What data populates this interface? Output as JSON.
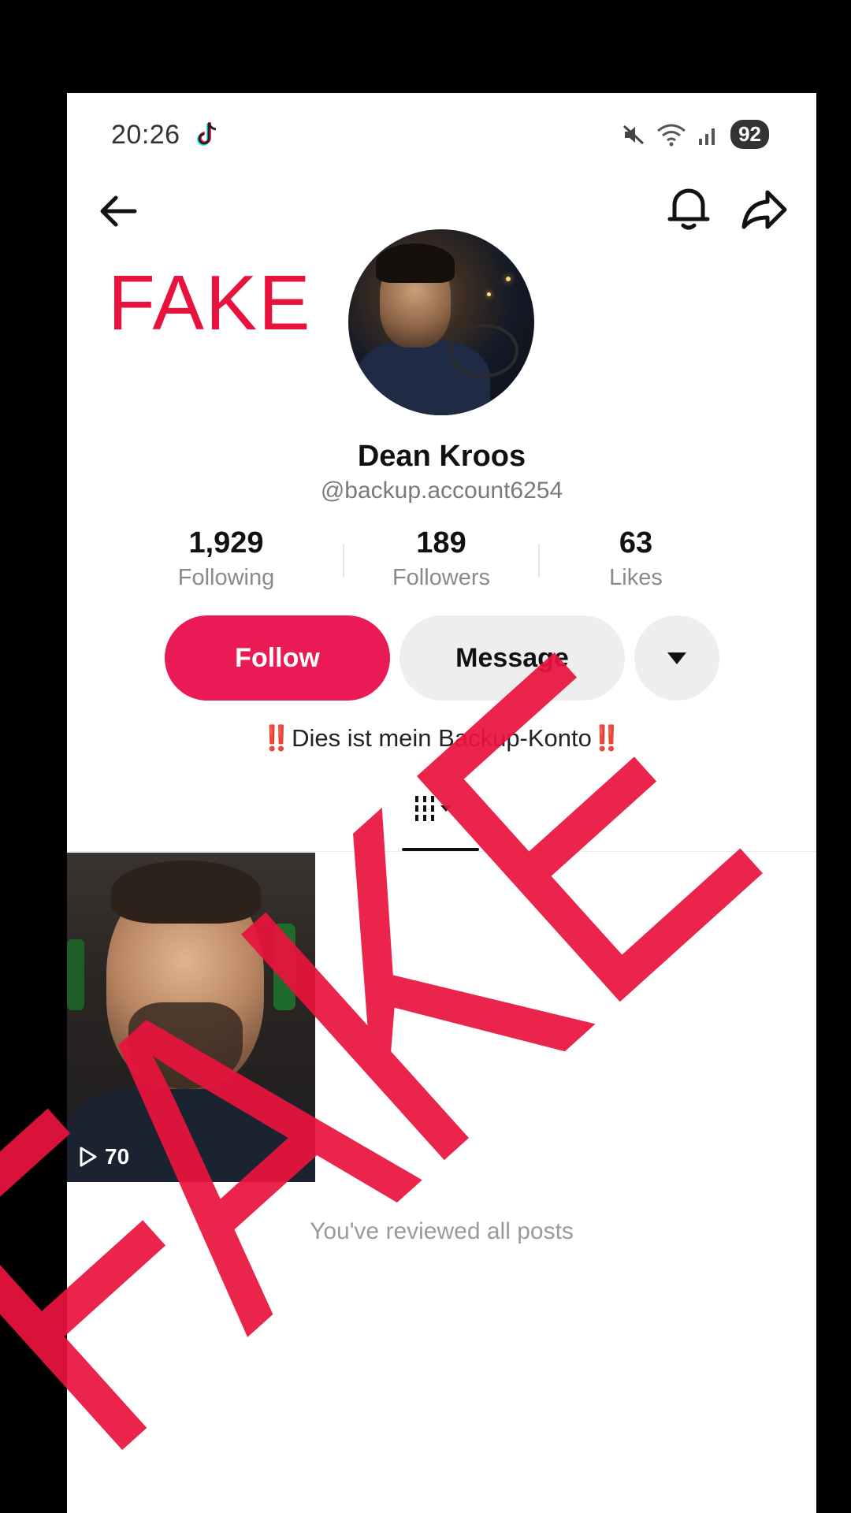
{
  "status_bar": {
    "time": "20:26",
    "battery": "92"
  },
  "watermark": {
    "small": "FAKE",
    "large": "FAKE",
    "color": "#e8133c"
  },
  "profile": {
    "name": "Dean Kroos",
    "handle": "@backup.account6254",
    "stats": [
      {
        "value": "1,929",
        "label": "Following"
      },
      {
        "value": "189",
        "label": "Followers"
      },
      {
        "value": "63",
        "label": "Likes"
      }
    ],
    "follow_label": "Follow",
    "message_label": "Message",
    "bio_mark": "‼️",
    "bio_text": "Dies ist mein Backup-Konto"
  },
  "posts": [
    {
      "views": "70"
    }
  ],
  "end_text": "You've reviewed all posts",
  "colors": {
    "accent": "#ea1a55",
    "button_gray": "#eeeeee"
  },
  "icons": [
    "tiktok-icon",
    "mute-icon",
    "wifi-icon",
    "signal-icon",
    "back-arrow-icon",
    "bell-icon",
    "share-icon",
    "chevron-down-icon",
    "grid-icon",
    "play-icon"
  ]
}
